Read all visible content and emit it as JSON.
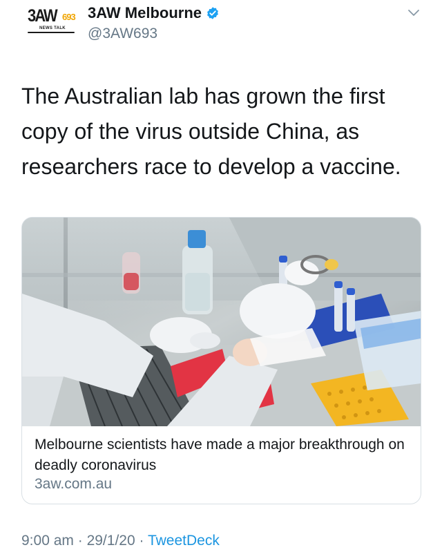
{
  "account": {
    "display_name": "3AW Melbourne",
    "handle": "@3AW693",
    "verified": true,
    "avatar_logo": {
      "main": "3AW",
      "number": "693",
      "sub": "NEWS TALK"
    }
  },
  "tweet": {
    "text": "The Australian lab has grown the first copy of the virus outside China, as researchers race to develop a vaccine."
  },
  "card": {
    "title": "Melbourne scientists have made a major breakthrough on deadly coronavirus",
    "domain": "3aw.com.au"
  },
  "meta": {
    "time": "9:00 am",
    "separator": "·",
    "date": "29/1/20",
    "source": "TweetDeck"
  },
  "colors": {
    "link_blue": "#1b95e0",
    "verified_blue": "#1da1f2",
    "muted_gray": "#657786",
    "text": "#14171a",
    "logo_orange": "#f0a400"
  },
  "icons": {
    "verified": "verified-badge-icon",
    "menu": "chevron-down-icon"
  }
}
